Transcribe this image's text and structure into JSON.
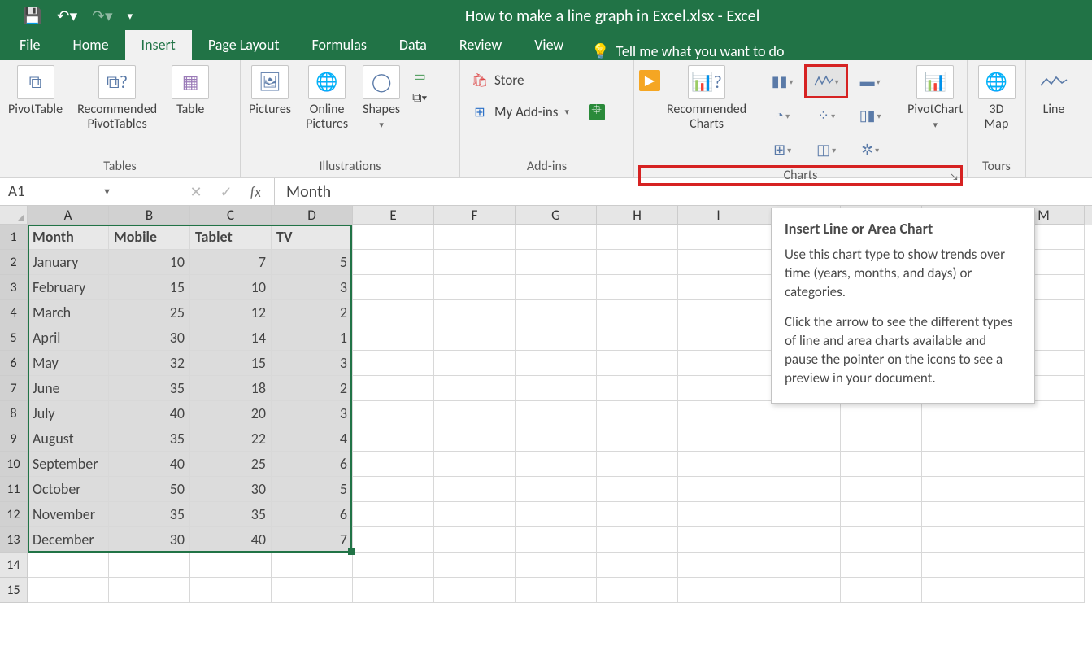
{
  "title": "How to make a line graph in Excel.xlsx  -  Excel",
  "tabs": {
    "file": "File",
    "home": "Home",
    "insert": "Insert",
    "pagelayout": "Page Layout",
    "formulas": "Formulas",
    "data": "Data",
    "review": "Review",
    "view": "View"
  },
  "tellme": "Tell me what you want to do",
  "ribbon": {
    "tables": {
      "pivot": "PivotTable",
      "recpivot": "Recommended\nPivotTables",
      "table": "Table",
      "label": "Tables"
    },
    "illus": {
      "pics": "Pictures",
      "online": "Online\nPictures",
      "shapes": "Shapes",
      "label": "Illustrations"
    },
    "addins": {
      "store": "Store",
      "myaddins": "My Add-ins",
      "label": "Add-ins"
    },
    "charts": {
      "rec": "Recommended\nCharts",
      "pivotchart": "PivotChart",
      "label": "Charts"
    },
    "tours": {
      "map": "3D\nMap",
      "label": "Tours"
    },
    "spark": {
      "line": "Line"
    }
  },
  "tooltip": {
    "title": "Insert Line or Area Chart",
    "p1": "Use this chart type to show trends over time (years, months, and days) or categories.",
    "p2": "Click the arrow to see the different types of line and area charts available and pause the pointer on the icons to see a preview in your document."
  },
  "namebox": "A1",
  "formulaValue": "Month",
  "columns": [
    "A",
    "B",
    "C",
    "D",
    "E",
    "F",
    "G",
    "H",
    "I",
    "",
    "",
    "",
    "M"
  ],
  "headers": [
    "Month",
    "Mobile",
    "Tablet",
    "TV"
  ],
  "data": [
    [
      "January",
      10,
      7,
      5
    ],
    [
      "February",
      15,
      10,
      3
    ],
    [
      "March",
      25,
      12,
      2
    ],
    [
      "April",
      30,
      14,
      1
    ],
    [
      "May",
      32,
      15,
      3
    ],
    [
      "June",
      35,
      18,
      2
    ],
    [
      "July",
      40,
      20,
      3
    ],
    [
      "August",
      35,
      22,
      4
    ],
    [
      "September",
      40,
      25,
      6
    ],
    [
      "October",
      50,
      30,
      5
    ],
    [
      "November",
      35,
      35,
      6
    ],
    [
      "December",
      30,
      40,
      7
    ]
  ],
  "chart_data": {
    "type": "line",
    "title": "",
    "xlabel": "Month",
    "ylabel": "",
    "categories": [
      "January",
      "February",
      "March",
      "April",
      "May",
      "June",
      "July",
      "August",
      "September",
      "October",
      "November",
      "December"
    ],
    "series": [
      {
        "name": "Mobile",
        "values": [
          10,
          15,
          25,
          30,
          32,
          35,
          40,
          35,
          40,
          50,
          35,
          30
        ]
      },
      {
        "name": "Tablet",
        "values": [
          7,
          10,
          12,
          14,
          15,
          18,
          20,
          22,
          25,
          30,
          35,
          40
        ]
      },
      {
        "name": "TV",
        "values": [
          5,
          3,
          2,
          1,
          3,
          2,
          3,
          4,
          6,
          5,
          6,
          7
        ]
      }
    ]
  }
}
